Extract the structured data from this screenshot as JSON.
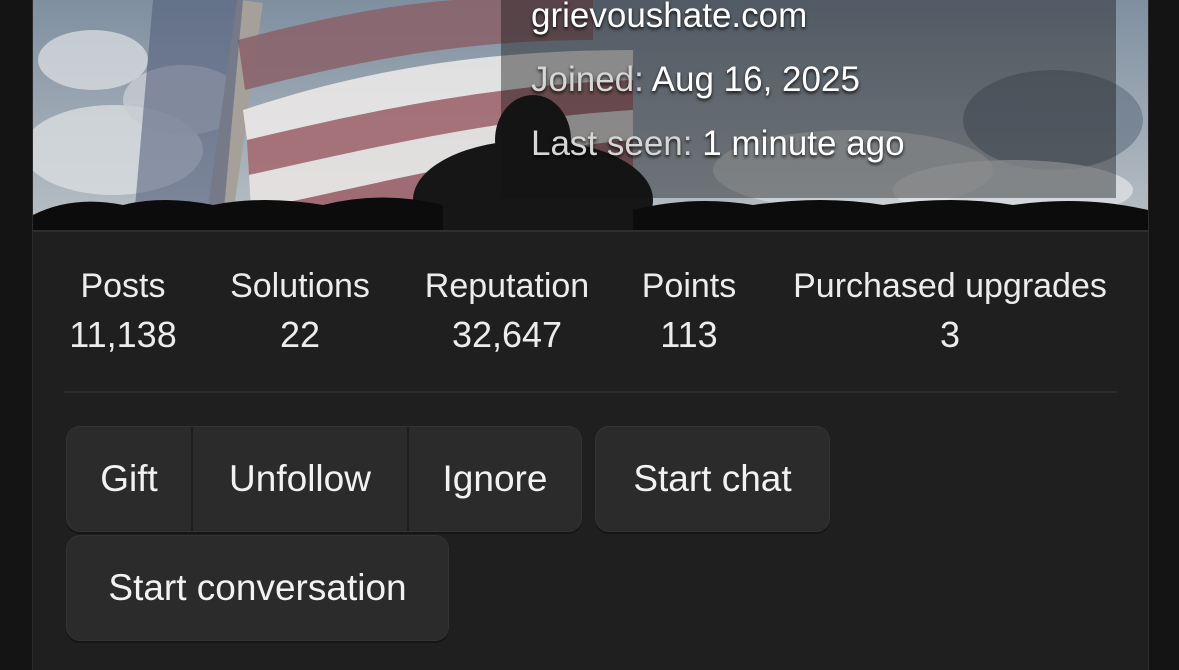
{
  "profile": {
    "website": "grievoushate.com",
    "joined_label": "Joined:",
    "joined_value": "Aug 16, 2025",
    "last_seen_label": "Last seen:",
    "last_seen_value": "1 minute ago"
  },
  "stats": [
    {
      "label": "Posts",
      "value": "11,138"
    },
    {
      "label": "Solutions",
      "value": "22"
    },
    {
      "label": "Reputation",
      "value": "32,647"
    },
    {
      "label": "Points",
      "value": "113"
    },
    {
      "label": "Purchased upgrades",
      "value": "3"
    }
  ],
  "actions": {
    "gift": "Gift",
    "unfollow": "Unfollow",
    "ignore": "Ignore",
    "start_chat": "Start chat",
    "start_conversation": "Start conversation"
  },
  "colors": {
    "background": "#141414",
    "card": "#1f1f1f",
    "button": "#2b2b2b",
    "text": "#f2f2f2"
  }
}
